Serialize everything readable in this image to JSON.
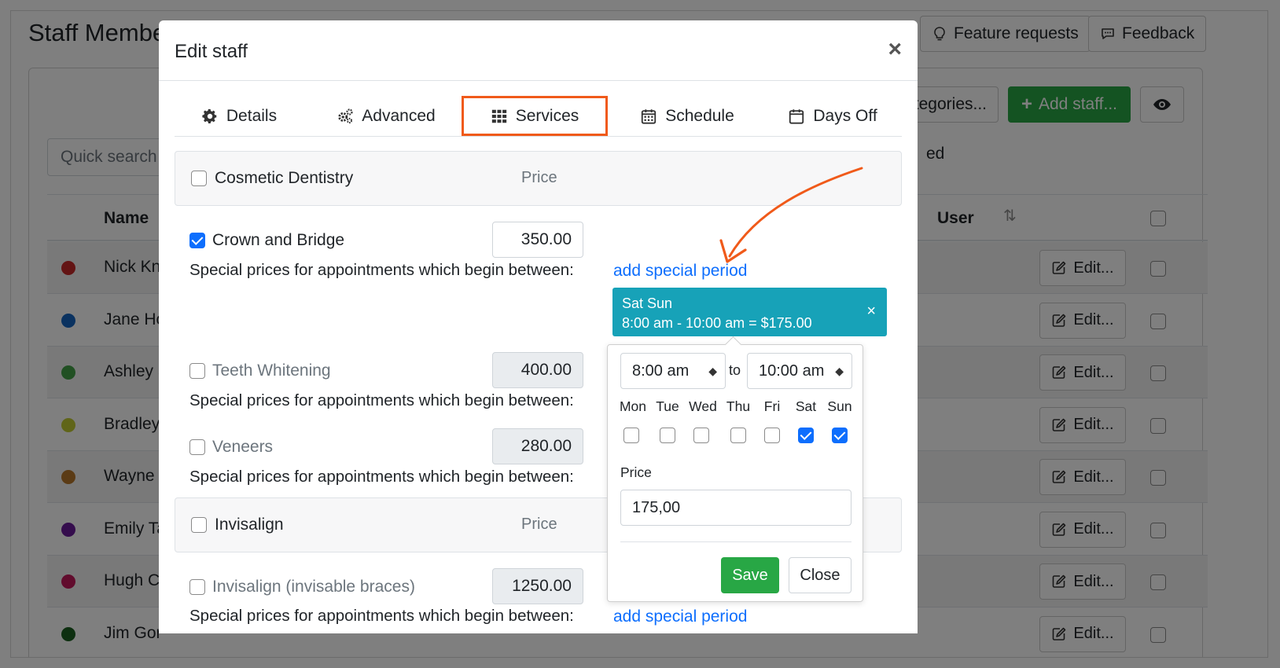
{
  "app": {
    "title": "Staff Members",
    "feature_requests": "Feature requests",
    "feedback": "Feedback",
    "categories_btn": "...tegories...",
    "add_staff": "Add staff...",
    "quick_search": "Quick search s",
    "bg_partial": "ed",
    "table": {
      "name_header": "Name",
      "user_header": "User",
      "rows": [
        {
          "name": "Nick Kni",
          "color": "#c62828",
          "edit": "Edit..."
        },
        {
          "name": "Jane Ho",
          "color": "#1565c0",
          "edit": "Edit..."
        },
        {
          "name": "Ashley S",
          "color": "#43a047",
          "edit": "Edit..."
        },
        {
          "name": "Bradley",
          "color": "#c0ca33",
          "edit": "Edit..."
        },
        {
          "name": "Wayne T",
          "color": "#b7762b",
          "edit": "Edit..."
        },
        {
          "name": "Emily Ta",
          "color": "#6a1b9a",
          "edit": "Edit..."
        },
        {
          "name": "Hugh Ca",
          "color": "#c2185b",
          "edit": "Edit..."
        },
        {
          "name": "Jim Gor",
          "color": "#1b5e20",
          "edit": "Edit..."
        }
      ]
    }
  },
  "modal": {
    "title": "Edit staff",
    "close": "×",
    "tabs": [
      {
        "label": "Details",
        "icon": "gear-icon"
      },
      {
        "label": "Advanced",
        "icon": "gears-icon"
      },
      {
        "label": "Services",
        "icon": "grid-icon",
        "active": true
      },
      {
        "label": "Schedule",
        "icon": "calendar-grid-icon"
      },
      {
        "label": "Days Off",
        "icon": "calendar-icon"
      }
    ],
    "groups": [
      {
        "name": "Cosmetic Dentistry",
        "price_label": "Price"
      },
      {
        "name": "Invisalign",
        "price_label": "Price"
      }
    ],
    "services": [
      {
        "name": "Crown and Bridge",
        "price": "350.00",
        "checked": true
      },
      {
        "name": "Teeth Whitening",
        "price": "400.00",
        "checked": false
      },
      {
        "name": "Veneers",
        "price": "280.00",
        "checked": false
      },
      {
        "name": "Invisalign (invisable braces)",
        "price": "1250.00",
        "checked": false
      }
    ],
    "special_prices_text": "Special prices for appointments which begin between:",
    "add_special_period": "add special period",
    "period": {
      "days": "Sat Sun",
      "summary": "8:00 am - 10:00 am = $175.00",
      "remove": "×"
    },
    "popover": {
      "from": "8:00 am",
      "to_label": "to",
      "to": "10:00 am",
      "days": [
        {
          "label": "Mon",
          "checked": false
        },
        {
          "label": "Tue",
          "checked": false
        },
        {
          "label": "Wed",
          "checked": false
        },
        {
          "label": "Thu",
          "checked": false
        },
        {
          "label": "Fri",
          "checked": false
        },
        {
          "label": "Sat",
          "checked": true
        },
        {
          "label": "Sun",
          "checked": true
        }
      ],
      "price_label": "Price",
      "price_value": "175,00",
      "save": "Save",
      "close": "Close"
    }
  },
  "colors": {
    "accent_orange": "#f05a1a",
    "link_blue": "#0d6efd",
    "badge_teal": "#17a2b8",
    "success_green": "#28a745"
  }
}
